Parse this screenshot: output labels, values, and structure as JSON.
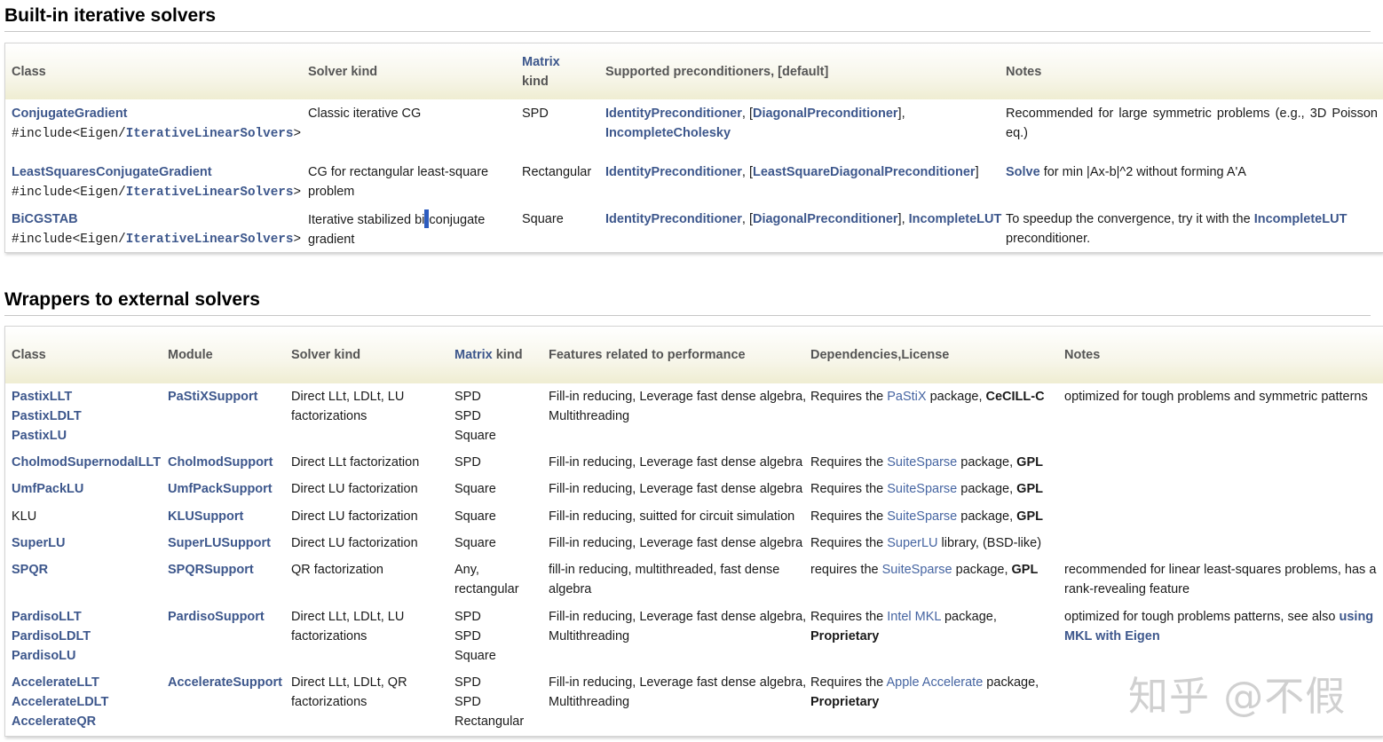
{
  "section1": {
    "title": "Built-in iterative solvers",
    "headers": {
      "class": "Class",
      "solver_kind": "Solver kind",
      "matrix_kind_link": "Matrix",
      "matrix_kind_rest": "kind",
      "preconditioners": "Supported preconditioners, [default]",
      "notes": "Notes"
    },
    "rows": [
      {
        "class": "ConjugateGradient",
        "include_prefix": "#include<Eigen/",
        "include_link": "IterativeLinearSolvers",
        "include_suffix": ">",
        "solver_kind_l1": "Classic iterative CG",
        "matrix_kind": "SPD",
        "pre_a": "IdentityPreconditioner",
        "pre_sep1": ", [",
        "pre_b": "DiagonalPreconditioner",
        "pre_sep2": "],",
        "pre_c": "IncompleteCholesky",
        "notes_l1": "Recommended for large symmetric problems (e.g., 3D Poisson",
        "notes_l2": "eq.)"
      },
      {
        "class": "LeastSquaresConjugateGradient",
        "include_prefix": "#include<Eigen/",
        "include_link": "IterativeLinearSolvers",
        "include_suffix": ">",
        "solver_kind_l1": "CG for rectangular least-square",
        "solver_kind_l2": "problem",
        "matrix_kind": "Rectangular",
        "pre_a": "IdentityPreconditioner",
        "pre_sep1": ", [",
        "pre_b": "LeastSquareDiagonalPreconditioner",
        "pre_sep2": "]",
        "notes_link": "Solve",
        "notes_rest": " for min |Ax-b|^2 without forming A'A"
      },
      {
        "class": "BiCGSTAB",
        "include_prefix": "#include<Eigen/",
        "include_link": "IterativeLinearSolvers",
        "include_suffix": ">",
        "solver_kind_a": "Iterative stabilized bi",
        "solver_kind_b": "conjugate",
        "solver_kind_l2": "gradient",
        "matrix_kind": "Square",
        "pre_a": "IdentityPreconditioner",
        "pre_sep1": ", [",
        "pre_b": "DiagonalPreconditioner",
        "pre_sep2": "], ",
        "pre_c": "IncompleteLUT",
        "notes_l1_text": "To speedup the convergence, try it with the ",
        "notes_l1_link": "IncompleteLUT",
        "notes_l2": "preconditioner."
      }
    ]
  },
  "section2": {
    "title": "Wrappers to external solvers",
    "headers": {
      "class": "Class",
      "module": "Module",
      "solver_kind": "Solver kind",
      "matrix_kind_link": "Matrix",
      "matrix_kind_rest": " kind",
      "features": "Features related to performance",
      "deps": "Dependencies,License",
      "notes": "Notes"
    },
    "rows": [
      {
        "classes": [
          "PastixLLT",
          "PastixLDLT",
          "PastixLU"
        ],
        "module": "PaStiXSupport",
        "solver": [
          "Direct LLt, LDLt, LU",
          "factorizations"
        ],
        "matrix": [
          "SPD",
          "SPD",
          "Square"
        ],
        "features": [
          "Fill-in reducing, Leverage fast dense algebra,",
          "Multithreading"
        ],
        "deps_pre": "Requires the ",
        "deps_link": "PaStiX",
        "deps_mid": " package, ",
        "deps_license": "CeCILL-C",
        "notes": [
          "optimized for tough problems and symmetric patterns"
        ]
      },
      {
        "classes": [
          "CholmodSupernodalLLT"
        ],
        "module": "CholmodSupport",
        "solver": [
          "Direct LLt factorization"
        ],
        "matrix": [
          "SPD"
        ],
        "features": [
          "Fill-in reducing, Leverage fast dense algebra"
        ],
        "deps_pre": "Requires the ",
        "deps_link": "SuiteSparse",
        "deps_mid": " package, ",
        "deps_license": "GPL"
      },
      {
        "classes": [
          "UmfPackLU"
        ],
        "module": "UmfPackSupport",
        "solver": [
          "Direct LU factorization"
        ],
        "matrix": [
          "Square"
        ],
        "features": [
          "Fill-in reducing, Leverage fast dense algebra"
        ],
        "deps_pre": "Requires the ",
        "deps_link": "SuiteSparse",
        "deps_mid": " package, ",
        "deps_license": "GPL"
      },
      {
        "classes_plain": "KLU",
        "module": "KLUSupport",
        "solver": [
          "Direct LU factorization"
        ],
        "matrix": [
          "Square"
        ],
        "features": [
          "Fill-in reducing, suitted for circuit simulation"
        ],
        "deps_pre": "Requires the ",
        "deps_link": "SuiteSparse",
        "deps_mid": " package, ",
        "deps_license": "GPL"
      },
      {
        "classes": [
          "SuperLU"
        ],
        "module": "SuperLUSupport",
        "solver": [
          "Direct LU factorization"
        ],
        "matrix": [
          "Square"
        ],
        "features": [
          "Fill-in reducing, Leverage fast dense algebra"
        ],
        "deps_pre": "Requires the ",
        "deps_link": "SuperLU",
        "deps_mid": " library, (BSD-like)"
      },
      {
        "classes": [
          "SPQR"
        ],
        "module": "SPQRSupport",
        "solver": [
          "QR factorization"
        ],
        "matrix": [
          "Any,",
          "rectangular"
        ],
        "features": [
          "fill-in reducing, multithreaded, fast dense",
          "algebra"
        ],
        "deps_pre": "requires the ",
        "deps_link": "SuiteSparse",
        "deps_mid": " package, ",
        "deps_license": "GPL",
        "notes": [
          "recommended for linear least-squares problems, has a",
          "rank-revealing feature"
        ]
      },
      {
        "classes": [
          "PardisoLLT",
          "PardisoLDLT",
          "PardisoLU"
        ],
        "module": "PardisoSupport",
        "solver": [
          "Direct LLt, LDLt, LU",
          "factorizations"
        ],
        "matrix": [
          "SPD",
          "SPD",
          "Square"
        ],
        "features": [
          "Fill-in reducing, Leverage fast dense algebra,",
          "Multithreading"
        ],
        "deps_pre": "Requires the ",
        "deps_link": "Intel MKL",
        "deps_mid": " package,",
        "deps_license": "Proprietary",
        "notes_pre": "optimized for tough problems patterns, see also ",
        "notes_link1": "using",
        "notes_link2": "MKL with Eigen"
      },
      {
        "classes": [
          "AccelerateLLT",
          "AccelerateLDLT",
          "AccelerateQR"
        ],
        "module": "AccelerateSupport",
        "solver": [
          "Direct LLt, LDLt, QR",
          "factorizations"
        ],
        "matrix": [
          "SPD",
          "SPD",
          "Rectangular"
        ],
        "features": [
          "Fill-in reducing, Leverage fast dense algebra,",
          "Multithreading"
        ],
        "deps_pre": "Requires the ",
        "deps_link": "Apple Accelerate",
        "deps_mid": " package,",
        "deps_license": "Proprietary"
      }
    ]
  },
  "watermark": "知乎 @不假",
  "colors": {
    "link": "#3d578c",
    "header_bg": "#f7f6ea",
    "cursor": "#2d5cbf"
  }
}
